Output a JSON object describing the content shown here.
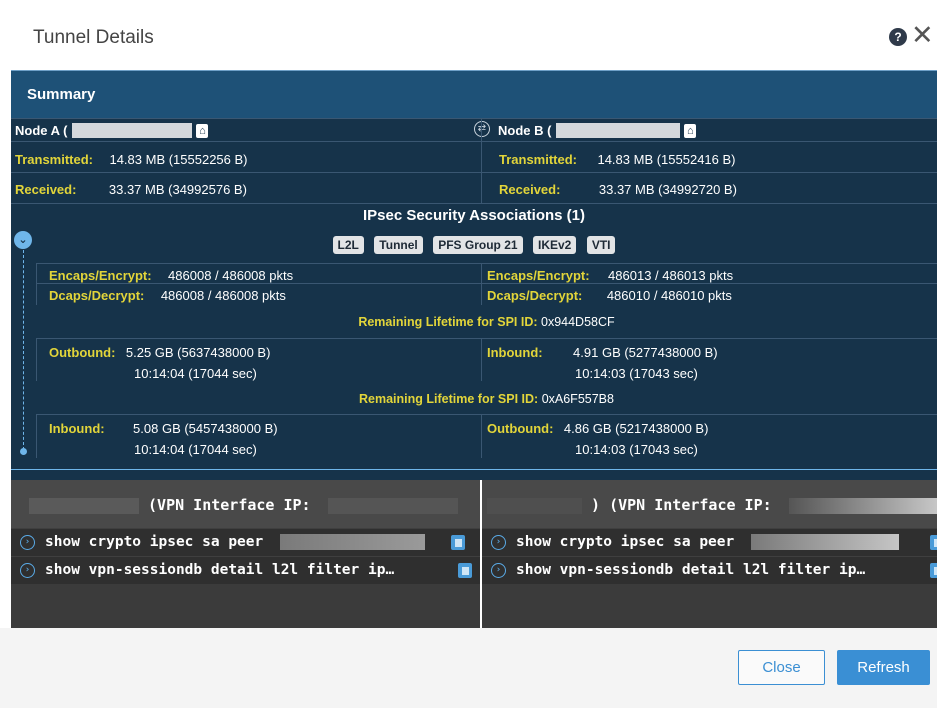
{
  "dialog": {
    "title": "Tunnel Details"
  },
  "summary": {
    "heading": "Summary",
    "node_a": {
      "label": "Node A ("
    },
    "node_b": {
      "label": "Node B ("
    },
    "transmitted_label": "Transmitted:",
    "received_label": "Received:",
    "a_transmitted": "14.83 MB (15552256 B)",
    "a_received": "33.37 MB (34992576 B)",
    "b_transmitted": "14.83 MB (15552416 B)",
    "b_received": "33.37 MB (34992720 B)"
  },
  "ipsec": {
    "title": "IPsec Security Associations (1)",
    "badges": [
      "L2L",
      "Tunnel",
      "PFS Group 21",
      "IKEv2",
      "VTI"
    ],
    "encaps_label": "Encaps/Encrypt:",
    "dcaps_label": "Dcaps/Decrypt:",
    "a_encaps": "486008 / 486008 pkts",
    "a_dcaps": "486008 / 486008 pkts",
    "b_encaps": "486013 / 486013 pkts",
    "b_dcaps": "486010 / 486010 pkts",
    "lifetime_label": "Remaining Lifetime for SPI ID:",
    "spi_1": "0x944D58CF",
    "spi_2": "0xA6F557B8",
    "outbound_label": "Outbound:",
    "inbound_label": "Inbound:",
    "spi1_a_size": "5.25 GB (5637438000 B)",
    "spi1_a_time": "10:14:04 (17044 sec)",
    "spi1_b_size": "4.91 GB (5277438000 B)",
    "spi1_b_time": "10:14:03 (17043 sec)",
    "spi2_a_size": "5.08 GB (5457438000 B)",
    "spi2_a_time": "10:14:04 (17044 sec)",
    "spi2_b_size": "4.86 GB (5217438000 B)",
    "spi2_b_time": "10:14:03 (17043 sec)"
  },
  "cli": {
    "left_header": "(VPN Interface IP:",
    "right_header": ") (VPN Interface IP:",
    "cmd_sa_peer": "show crypto ipsec sa peer",
    "cmd_vpn_session": "show vpn-sessiondb detail l2l filter ip…"
  },
  "footer": {
    "close_label": "Close",
    "refresh_label": "Refresh"
  },
  "colors": {
    "panel": "#16334a",
    "summary_header": "#1e5177",
    "label": "#e2d53a",
    "accent": "#3a8fd4",
    "cli_bg": "#3b3b3b"
  }
}
